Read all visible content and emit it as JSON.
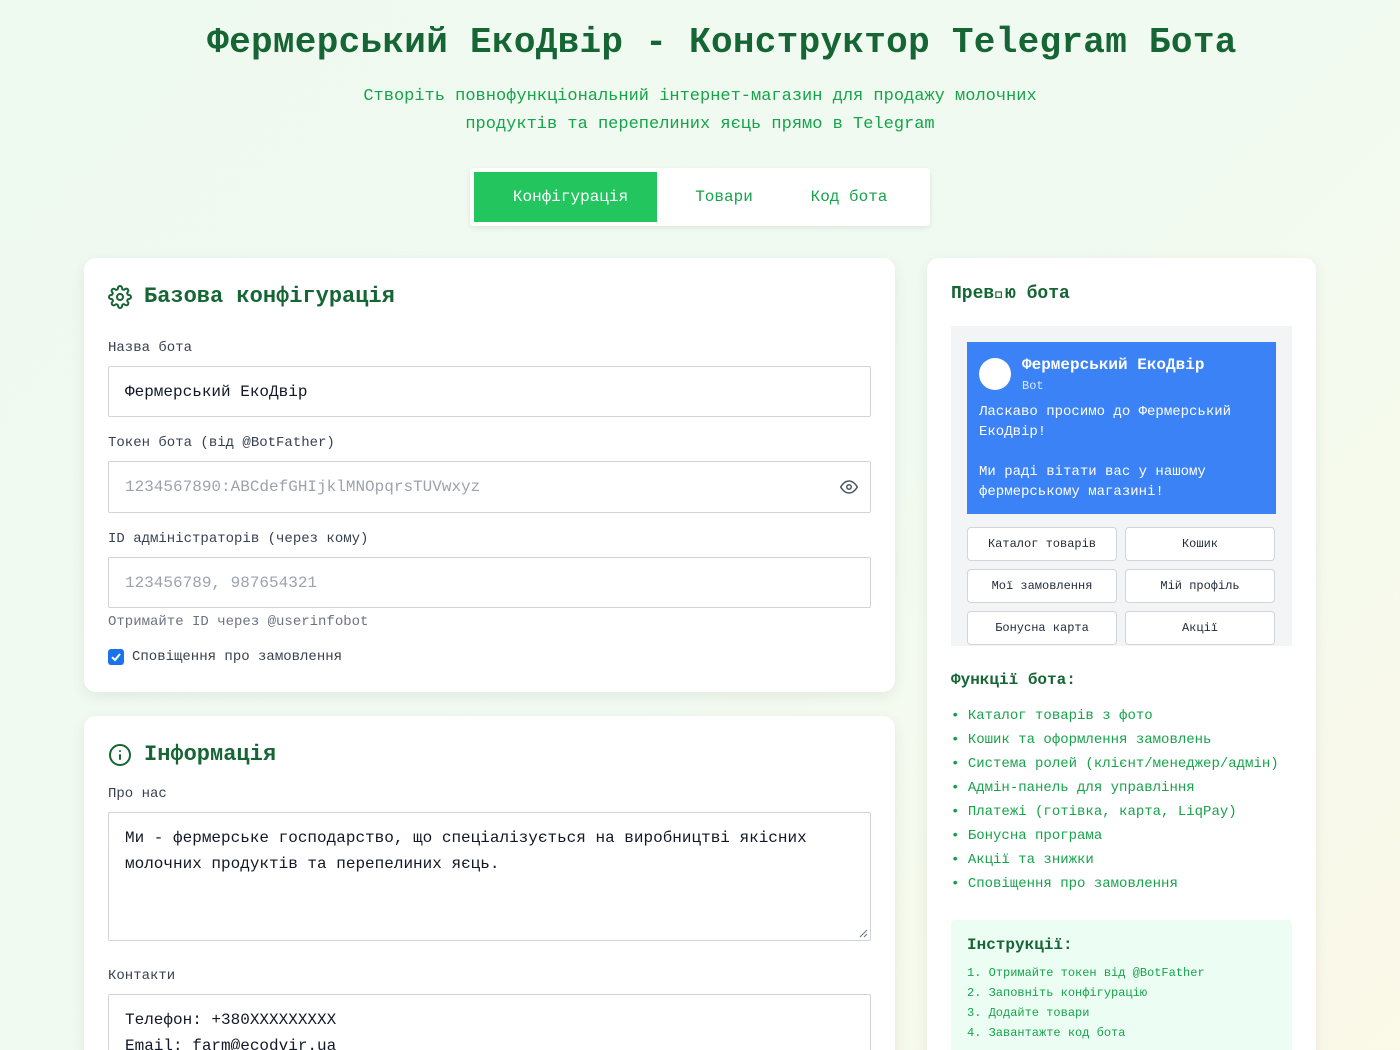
{
  "header": {
    "icon": "",
    "title": "Фермерський ЕкоДвір - Конструктор Telegram Бота",
    "subtitle": "Створіть повнофункціональний інтернет-магазин для продажу молочних продуктів та перепелиних яєць прямо в Telegram"
  },
  "tabs": [
    {
      "icon": "",
      "label": "Конфігурація",
      "active": true
    },
    {
      "icon": "",
      "label": "Товари",
      "active": false
    },
    {
      "icon": "",
      "label": "Код бота",
      "active": false
    }
  ],
  "config": {
    "title": "Базова конфігурація",
    "title_icon": "gear-icon",
    "bot_name_label": "Назва бота",
    "bot_name_value": "Фермерський ЕкоДвір",
    "token_label": "Токен бота (від @BotFather)",
    "token_placeholder": "1234567890:ABCdefGHIjklMNOpqrsTUVwxyz",
    "admin_label": "ID адміністраторів (через кому)",
    "admin_placeholder": "123456789, 987654321",
    "admin_hint": "Отримайте ID через @userinfobot",
    "notify_label": "Сповіщення про замовлення",
    "notify_checked": true
  },
  "info": {
    "title": "Інформація",
    "title_icon": "info-icon",
    "about_label": "Про нас",
    "about_value": "Ми - фермерське господарство, що спеціалізується на виробництві якісних молочних продуктів та перепелиних яєць.",
    "contacts_label": "Контакти",
    "contacts_line1": " Телефон: +380XXXXXXXXX",
    "contacts_line2": " Email: farm@ecodvir.ua"
  },
  "preview": {
    "title": " Прев\u0000ю бота",
    "bot_name": "Фермерський ЕкоДвір",
    "bot_sub": "Bot",
    "message": " Ласкаво просимо до Фермерський ЕкоДвір! \n\nМи раді вітати вас у нашому фермерському магазині!",
    "keyboard": [
      " Каталог товарів",
      " Кошик",
      " Мої замовлення",
      " Мій профіль",
      " Бонусна карта",
      " Акції"
    ],
    "features_title": " Функції бота:",
    "features": [
      "Каталог товарів з фото",
      "Кошик та оформлення замовлень",
      "Система ролей (клієнт/менеджер/адмін)",
      "Адмін-панель для управління",
      "Платежі (готівка, карта, LiqPay)",
      "Бонусна програма",
      "Акції та знижки",
      "Сповіщення про замовлення"
    ],
    "instructions_title": " Інструкції:",
    "instructions": [
      "1. Отримайте токен від @BotFather",
      "2. Заповніть конфігурацію",
      "3. Додайте товари",
      "4. Завантажте код бота"
    ]
  },
  "colors": {
    "primary": "#22c55e",
    "dark_green": "#166534",
    "accent_green": "#16a34a",
    "telegram_blue": "#3b82f6"
  }
}
